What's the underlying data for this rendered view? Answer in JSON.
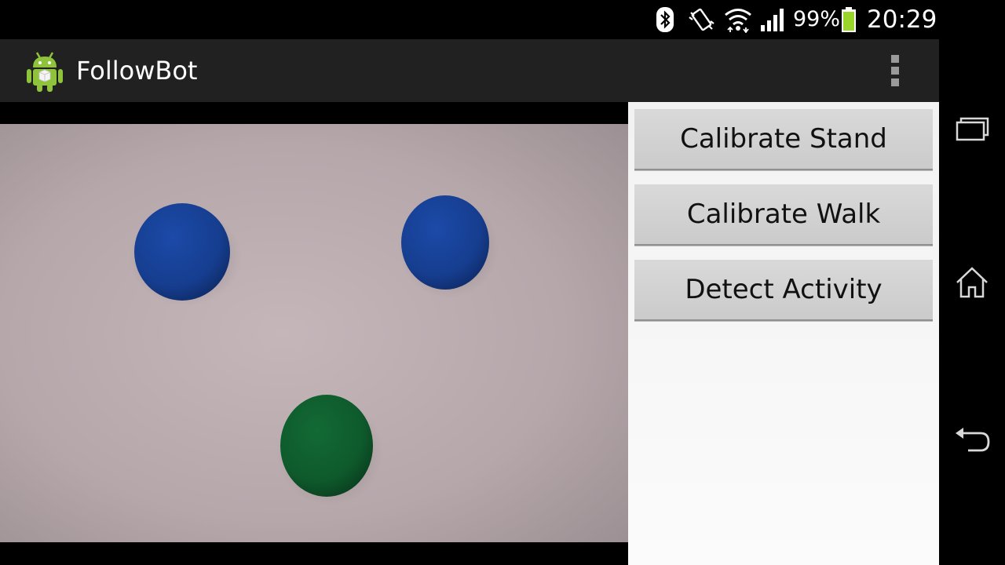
{
  "status_bar": {
    "battery_percent": "99%",
    "time": "20:29",
    "icons": [
      "bluetooth-icon",
      "vibrate-icon",
      "wifi-icon",
      "signal-icon",
      "battery-icon"
    ]
  },
  "action_bar": {
    "app_title": "FollowBot",
    "app_icon": "android-robot-icon",
    "overflow_icon": "overflow-menu-icon"
  },
  "buttons": [
    {
      "label": "Calibrate Stand"
    },
    {
      "label": "Calibrate Walk"
    },
    {
      "label": "Detect Activity"
    }
  ],
  "navigation": {
    "icons": [
      "recent-apps-icon",
      "home-icon",
      "back-icon"
    ]
  },
  "colors": {
    "accent_battery": "#9ad52a",
    "action_bar": "#212121",
    "ball_blue": "#163e90",
    "ball_green": "#0e5a2c",
    "button_face": "#d3d3d3"
  }
}
